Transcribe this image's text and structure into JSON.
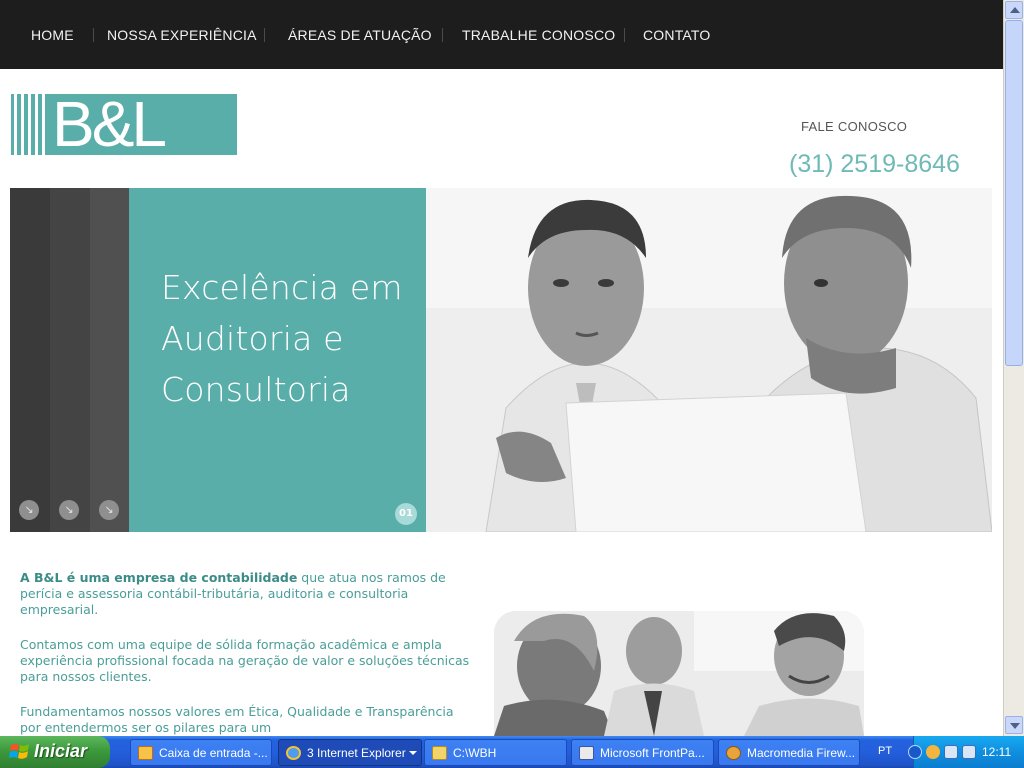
{
  "nav": {
    "items": [
      "HOME",
      "NOSSA EXPERIÊNCIA",
      "ÁREAS DE ATUAÇÃO",
      "TRABALHE CONOSCO",
      "CONTATO"
    ]
  },
  "header": {
    "logo_text": "B&L",
    "contact_label": "FALE CONOSCO",
    "phone": "(31) 2519-8646"
  },
  "hero": {
    "title_lines": [
      "Excelência em",
      "Auditoria e",
      "Consultoria"
    ],
    "slide_number": "01",
    "nav_arrow": "↘"
  },
  "content": {
    "p1_strong": "A B&L é uma empresa de contabilidade",
    "p1_rest": " que atua nos ramos de perícia e assessoria contábil-tributária, auditoria e consultoria empresarial.",
    "p2": "Contamos com uma equipe de sólida formação acadêmica e ampla experiência profissional focada na geração de valor e soluções técnicas para nossos clientes.",
    "p3": "Fundamentamos nossos valores em Ética, Qualidade e Transparência por entendermos ser os pilares para um"
  },
  "taskbar": {
    "start_label": "Iniciar",
    "tasks": [
      {
        "label": "Caixa de entrada -...",
        "icon": "mail-icon"
      },
      {
        "label": "3 Internet Explorer",
        "icon": "ie-icon"
      },
      {
        "label": "C:\\WBH",
        "icon": "folder-icon"
      },
      {
        "label": "Microsoft FrontPa...",
        "icon": "frontpage-icon"
      },
      {
        "label": "Macromedia Firew...",
        "icon": "fireworks-icon"
      }
    ],
    "language": "PT",
    "clock": "12:11"
  },
  "colors": {
    "accent": "#5aaeaa",
    "nav_bg": "#1d1d1d",
    "text": "#4a9e99",
    "taskbar": "#245edc"
  }
}
